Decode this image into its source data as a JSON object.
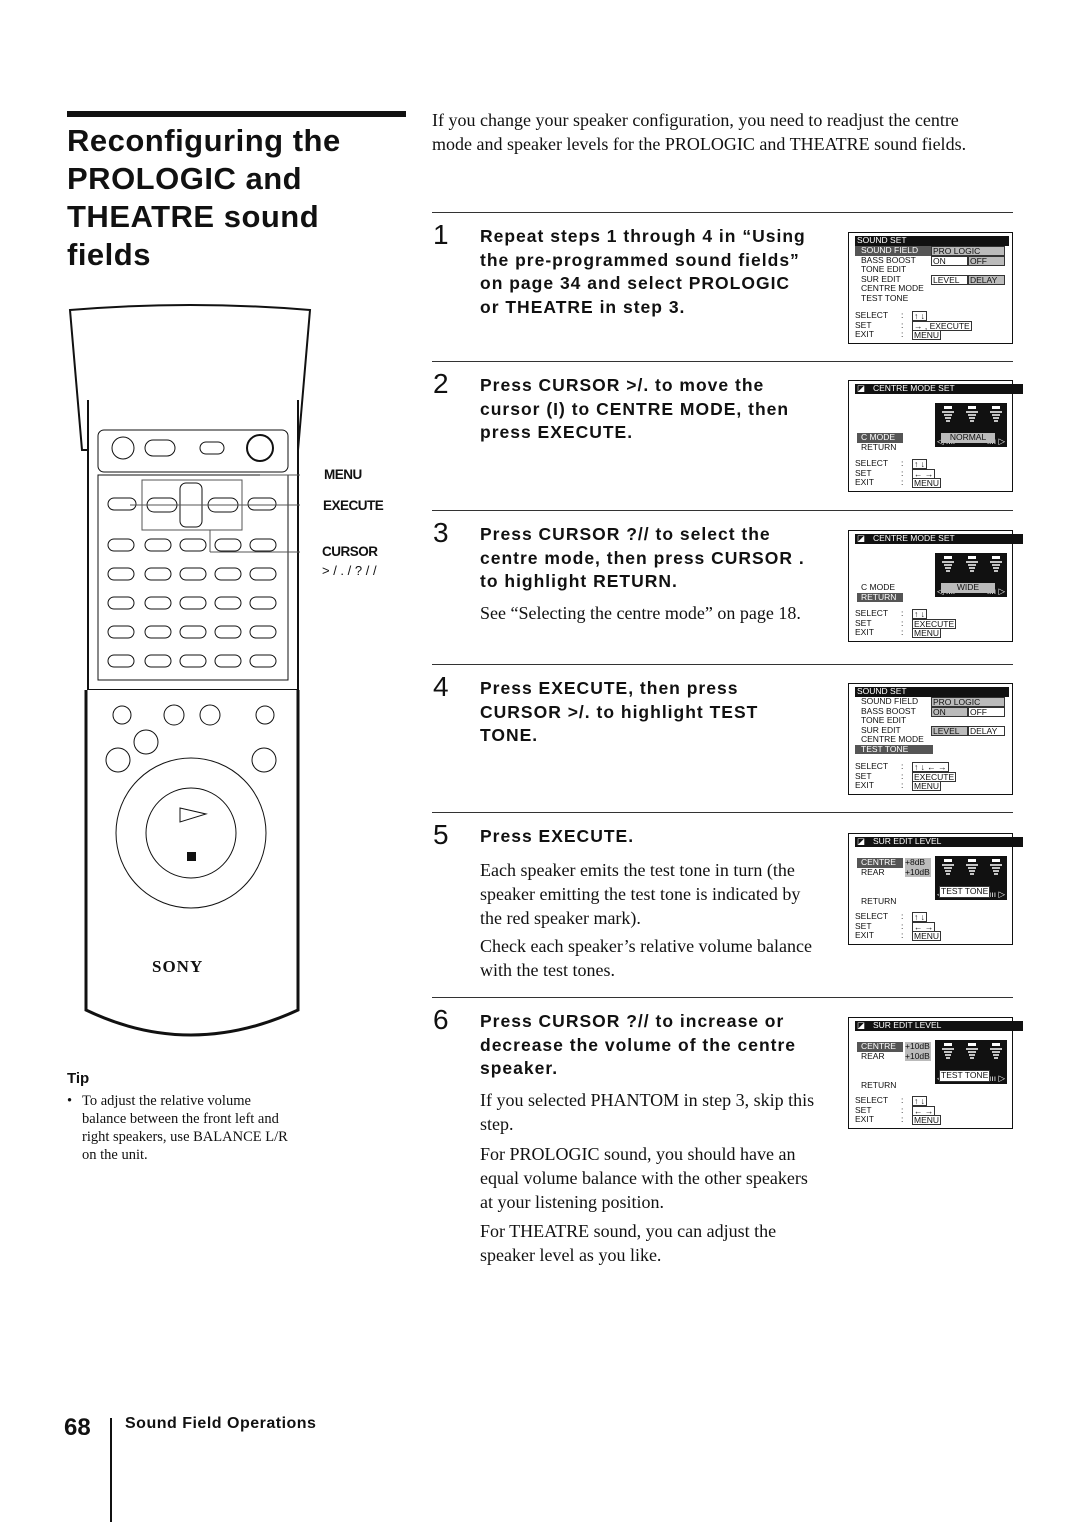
{
  "title": "Reconfiguring the PROLOGIC and THEATRE sound fields",
  "intro": "If you change your speaker configuration, you need to readjust the centre mode and speaker levels for the PROLOGIC and THEATRE sound fields.",
  "remote": {
    "brand": "SONY",
    "labels": {
      "menu": "MENU",
      "execute": "EXECUTE",
      "cursor": "CURSOR",
      "cursor_keys": "> / . / ? / /"
    }
  },
  "tip": {
    "heading": "Tip",
    "bullet": "To adjust the relative volume balance between the front left and right speakers, use BALANCE L/R on the unit."
  },
  "steps": [
    {
      "number": "1",
      "instruction": "Repeat steps 1 through 4 in “Using the pre-programmed sound fields” on page 34 and select PROLOGIC or THEATRE in step 3.",
      "notes": []
    },
    {
      "number": "2",
      "instruction": "Press CURSOR >/. to move the cursor (I) to CENTRE MODE, then press EXECUTE.",
      "notes": []
    },
    {
      "number": "3",
      "instruction": "Press CURSOR ?// to select the centre mode, then press CURSOR . to highlight RETURN.",
      "notes": [
        "See “Selecting the centre mode” on page 18."
      ]
    },
    {
      "number": "4",
      "instruction": "Press EXECUTE, then press CURSOR >/. to highlight TEST TONE.",
      "notes": []
    },
    {
      "number": "5",
      "instruction": "Press EXECUTE.",
      "notes": [
        "Each speaker emits the test tone in turn (the speaker emitting the test tone is indicated by the red speaker mark).",
        "Check each speaker’s relative volume balance with the test tones."
      ]
    },
    {
      "number": "6",
      "instruction": "Press CURSOR ?// to increase or decrease the volume of the centre speaker.",
      "notes": [
        "If you selected PHANTOM in step 3, skip this step.",
        "For PROLOGIC sound, you should have an equal volume balance with the other speakers at your listening position.",
        "For THEATRE sound, you can adjust the speaker level as you like."
      ]
    }
  ],
  "screens": [
    {
      "type": "sound-set",
      "title": "SOUND SET",
      "rows": [
        {
          "label": "SOUND FIELD",
          "highlight": true,
          "opts": [
            "PRO LOGIC"
          ]
        },
        {
          "label": "BASS BOOST",
          "opts": [
            "ON",
            "OFF"
          ],
          "sel": 1
        },
        {
          "label": "TONE EDIT"
        },
        {
          "label": "SUR EDIT",
          "opts": [
            "LEVEL",
            "DELAY"
          ],
          "sel": 1
        },
        {
          "label": "CENTRE MODE"
        },
        {
          "label": "TEST TONE"
        }
      ],
      "footer": [
        {
          "label": "SELECT",
          "keys": "↑ ↓"
        },
        {
          "label": "SET",
          "keys": "→ , EXECUTE"
        },
        {
          "label": "EXIT",
          "keys": "MENU"
        }
      ]
    },
    {
      "type": "centre",
      "title": "CENTRE MODE SET",
      "rows": [
        {
          "label": "C MODE",
          "highlight": true
        },
        {
          "label": "RETURN"
        }
      ],
      "value": "NORMAL",
      "footer": [
        {
          "label": "SELECT",
          "keys": "↑ ↓"
        },
        {
          "label": "SET",
          "keys": "← →"
        },
        {
          "label": "EXIT",
          "keys": "MENU"
        }
      ]
    },
    {
      "type": "centre",
      "title": "CENTRE MODE SET",
      "rows": [
        {
          "label": "C MODE"
        },
        {
          "label": "RETURN",
          "highlight": true
        }
      ],
      "value": "WIDE",
      "footer": [
        {
          "label": "SELECT",
          "keys": "↑ ↓"
        },
        {
          "label": "SET",
          "keys": "EXECUTE"
        },
        {
          "label": "EXIT",
          "keys": "MENU"
        }
      ]
    },
    {
      "type": "sound-set",
      "title": "SOUND SET",
      "rows": [
        {
          "label": "SOUND FIELD",
          "opts": [
            "PRO LOGIC"
          ]
        },
        {
          "label": "BASS BOOST",
          "opts": [
            "ON",
            "OFF"
          ],
          "sel": 0
        },
        {
          "label": "TONE EDIT"
        },
        {
          "label": "SUR EDIT",
          "opts": [
            "LEVEL",
            "DELAY"
          ],
          "sel": 0
        },
        {
          "label": "CENTRE MODE"
        },
        {
          "label": "TEST TONE",
          "highlight": true
        }
      ],
      "footer": [
        {
          "label": "SELECT",
          "keys": "↑ ↓ ← →"
        },
        {
          "label": "SET",
          "keys": "EXECUTE"
        },
        {
          "label": "EXIT",
          "keys": "MENU"
        }
      ]
    },
    {
      "type": "level",
      "title": "SUR EDIT LEVEL",
      "rows": [
        {
          "label": "CENTRE",
          "highlight": true,
          "val": "+8dB"
        },
        {
          "label": "REAR",
          "val": "+10dB"
        },
        {
          "label": "RETURN"
        }
      ],
      "value": "TEST TONE",
      "footer": [
        {
          "label": "SELECT",
          "keys": "↑ ↓"
        },
        {
          "label": "SET",
          "keys": "← →"
        },
        {
          "label": "EXIT",
          "keys": "MENU"
        }
      ]
    },
    {
      "type": "level",
      "title": "SUR EDIT LEVEL",
      "rows": [
        {
          "label": "CENTRE",
          "highlight": true,
          "val": "+10dB"
        },
        {
          "label": "REAR",
          "val": "+10dB"
        },
        {
          "label": "RETURN"
        }
      ],
      "value": "TEST TONE",
      "footer": [
        {
          "label": "SELECT",
          "keys": "↑ ↓"
        },
        {
          "label": "SET",
          "keys": "← →"
        },
        {
          "label": "EXIT",
          "keys": "MENU"
        }
      ]
    }
  ],
  "footer": {
    "page_number": "68",
    "section": "Sound Field Operations"
  }
}
